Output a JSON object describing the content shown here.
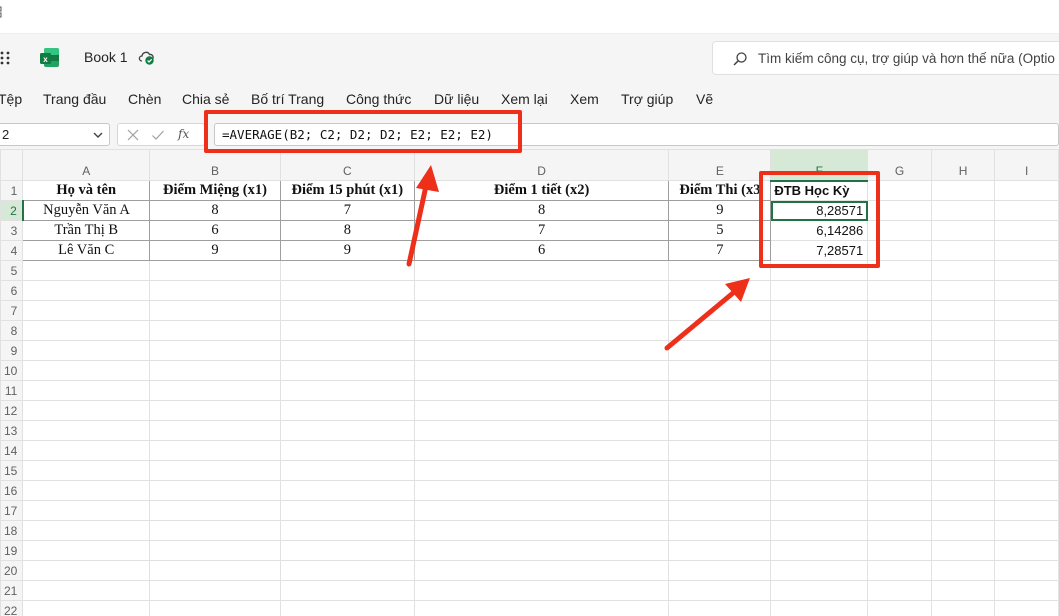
{
  "app": {
    "doc_title": "Book 1",
    "search_placeholder": "Tìm kiếm công cụ, trợ giúp và hơn thế nữa (Optio"
  },
  "ribbon": {
    "tabs": [
      "Tệp",
      "Trang đầu",
      "Chèn",
      "Chia sẻ",
      "Bố trí Trang",
      "Công thức",
      "Dữ liệu",
      "Xem lại",
      "Xem",
      "Trợ giúp",
      "Vẽ"
    ]
  },
  "formula_bar": {
    "name_box": "2",
    "fx_label": "fx",
    "formula": "=AVERAGE(B2; C2; D2; D2; E2; E2; E2)"
  },
  "sheet": {
    "columns": [
      "A",
      "B",
      "C",
      "D",
      "E",
      "F",
      "G",
      "H",
      "I"
    ],
    "row_numbers": [
      "1",
      "2",
      "3",
      "4",
      "5",
      "6",
      "7",
      "8",
      "9",
      "10",
      "11",
      "12",
      "13",
      "14",
      "15",
      "16",
      "17",
      "18",
      "19",
      "20",
      "21",
      "22"
    ],
    "header_row": [
      "Họ và tên",
      "Điểm Miệng (x1)",
      "Điểm 15 phút (x1)",
      "Điểm 1 tiết (x2)",
      "Điểm Thi (x3",
      "ĐTB Học Kỳ"
    ],
    "data_rows": [
      [
        "Nguyễn Văn A",
        "8",
        "7",
        "8",
        "9",
        "8,28571"
      ],
      [
        "Trần Thị B",
        "6",
        "8",
        "7",
        "5",
        "6,14286"
      ],
      [
        "Lê Văn C",
        "9",
        "9",
        "6",
        "7",
        "7,28571"
      ]
    ]
  },
  "colors": {
    "annotation_red": "#ee2f1a",
    "selection_green": "#217346"
  }
}
